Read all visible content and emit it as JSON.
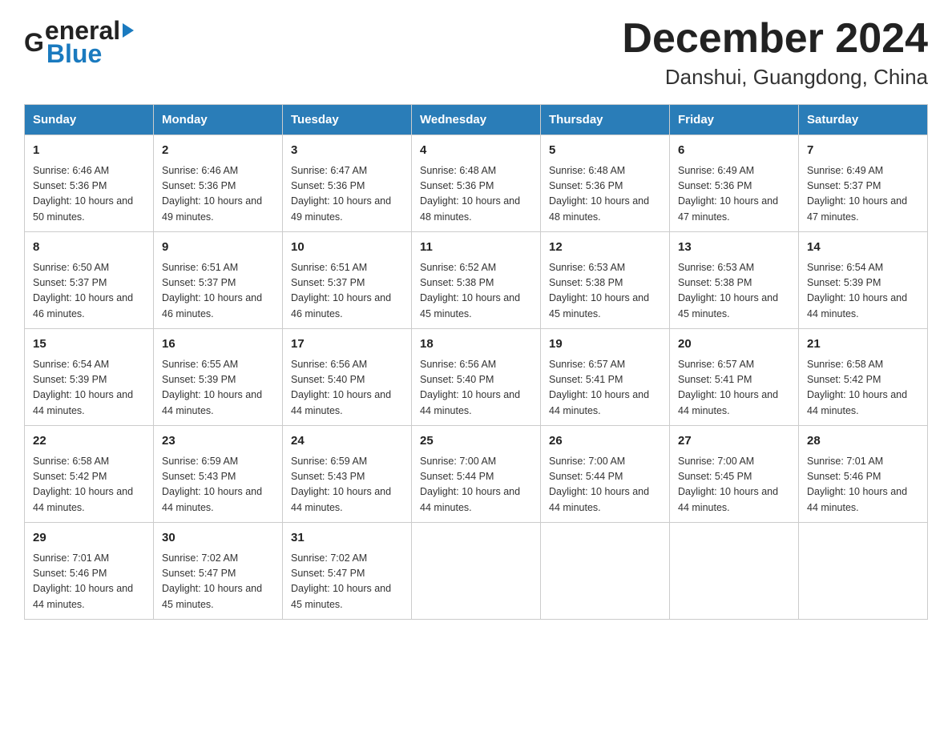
{
  "header": {
    "logo_text_black": "General",
    "logo_text_blue": "Blue",
    "month_title": "December 2024",
    "location": "Danshui, Guangdong, China"
  },
  "weekdays": [
    "Sunday",
    "Monday",
    "Tuesday",
    "Wednesday",
    "Thursday",
    "Friday",
    "Saturday"
  ],
  "weeks": [
    [
      {
        "day": "1",
        "sunrise": "6:46 AM",
        "sunset": "5:36 PM",
        "daylight": "10 hours and 50 minutes."
      },
      {
        "day": "2",
        "sunrise": "6:46 AM",
        "sunset": "5:36 PM",
        "daylight": "10 hours and 49 minutes."
      },
      {
        "day": "3",
        "sunrise": "6:47 AM",
        "sunset": "5:36 PM",
        "daylight": "10 hours and 49 minutes."
      },
      {
        "day": "4",
        "sunrise": "6:48 AM",
        "sunset": "5:36 PM",
        "daylight": "10 hours and 48 minutes."
      },
      {
        "day": "5",
        "sunrise": "6:48 AM",
        "sunset": "5:36 PM",
        "daylight": "10 hours and 48 minutes."
      },
      {
        "day": "6",
        "sunrise": "6:49 AM",
        "sunset": "5:36 PM",
        "daylight": "10 hours and 47 minutes."
      },
      {
        "day": "7",
        "sunrise": "6:49 AM",
        "sunset": "5:37 PM",
        "daylight": "10 hours and 47 minutes."
      }
    ],
    [
      {
        "day": "8",
        "sunrise": "6:50 AM",
        "sunset": "5:37 PM",
        "daylight": "10 hours and 46 minutes."
      },
      {
        "day": "9",
        "sunrise": "6:51 AM",
        "sunset": "5:37 PM",
        "daylight": "10 hours and 46 minutes."
      },
      {
        "day": "10",
        "sunrise": "6:51 AM",
        "sunset": "5:37 PM",
        "daylight": "10 hours and 46 minutes."
      },
      {
        "day": "11",
        "sunrise": "6:52 AM",
        "sunset": "5:38 PM",
        "daylight": "10 hours and 45 minutes."
      },
      {
        "day": "12",
        "sunrise": "6:53 AM",
        "sunset": "5:38 PM",
        "daylight": "10 hours and 45 minutes."
      },
      {
        "day": "13",
        "sunrise": "6:53 AM",
        "sunset": "5:38 PM",
        "daylight": "10 hours and 45 minutes."
      },
      {
        "day": "14",
        "sunrise": "6:54 AM",
        "sunset": "5:39 PM",
        "daylight": "10 hours and 44 minutes."
      }
    ],
    [
      {
        "day": "15",
        "sunrise": "6:54 AM",
        "sunset": "5:39 PM",
        "daylight": "10 hours and 44 minutes."
      },
      {
        "day": "16",
        "sunrise": "6:55 AM",
        "sunset": "5:39 PM",
        "daylight": "10 hours and 44 minutes."
      },
      {
        "day": "17",
        "sunrise": "6:56 AM",
        "sunset": "5:40 PM",
        "daylight": "10 hours and 44 minutes."
      },
      {
        "day": "18",
        "sunrise": "6:56 AM",
        "sunset": "5:40 PM",
        "daylight": "10 hours and 44 minutes."
      },
      {
        "day": "19",
        "sunrise": "6:57 AM",
        "sunset": "5:41 PM",
        "daylight": "10 hours and 44 minutes."
      },
      {
        "day": "20",
        "sunrise": "6:57 AM",
        "sunset": "5:41 PM",
        "daylight": "10 hours and 44 minutes."
      },
      {
        "day": "21",
        "sunrise": "6:58 AM",
        "sunset": "5:42 PM",
        "daylight": "10 hours and 44 minutes."
      }
    ],
    [
      {
        "day": "22",
        "sunrise": "6:58 AM",
        "sunset": "5:42 PM",
        "daylight": "10 hours and 44 minutes."
      },
      {
        "day": "23",
        "sunrise": "6:59 AM",
        "sunset": "5:43 PM",
        "daylight": "10 hours and 44 minutes."
      },
      {
        "day": "24",
        "sunrise": "6:59 AM",
        "sunset": "5:43 PM",
        "daylight": "10 hours and 44 minutes."
      },
      {
        "day": "25",
        "sunrise": "7:00 AM",
        "sunset": "5:44 PM",
        "daylight": "10 hours and 44 minutes."
      },
      {
        "day": "26",
        "sunrise": "7:00 AM",
        "sunset": "5:44 PM",
        "daylight": "10 hours and 44 minutes."
      },
      {
        "day": "27",
        "sunrise": "7:00 AM",
        "sunset": "5:45 PM",
        "daylight": "10 hours and 44 minutes."
      },
      {
        "day": "28",
        "sunrise": "7:01 AM",
        "sunset": "5:46 PM",
        "daylight": "10 hours and 44 minutes."
      }
    ],
    [
      {
        "day": "29",
        "sunrise": "7:01 AM",
        "sunset": "5:46 PM",
        "daylight": "10 hours and 44 minutes."
      },
      {
        "day": "30",
        "sunrise": "7:02 AM",
        "sunset": "5:47 PM",
        "daylight": "10 hours and 45 minutes."
      },
      {
        "day": "31",
        "sunrise": "7:02 AM",
        "sunset": "5:47 PM",
        "daylight": "10 hours and 45 minutes."
      },
      null,
      null,
      null,
      null
    ]
  ]
}
